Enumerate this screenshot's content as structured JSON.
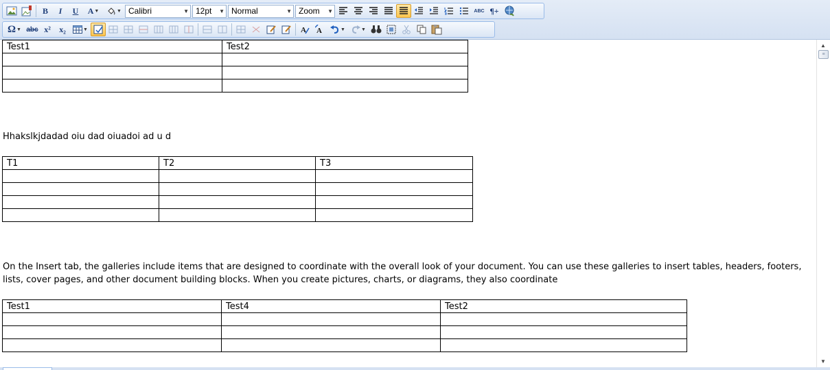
{
  "toolbar": {
    "font_family": "Calibri",
    "font_size": "12pt",
    "paragraph_style": "Normal",
    "zoom": "Zoom",
    "bold_glyph": "B",
    "italic_glyph": "I",
    "underline_glyph": "U",
    "font_color_glyph": "A",
    "omega_glyph": "Ω",
    "strikethrough_glyph": "abc",
    "superscript_glyph": "x²",
    "subscript_glyph": "x₂",
    "spellcheck_glyph": "ABC",
    "paragraph_mark_glyph": "¶+"
  },
  "document": {
    "table1": {
      "header": [
        "Test1",
        "Test2"
      ],
      "rows": [
        [
          "",
          ""
        ],
        [
          "",
          ""
        ],
        [
          "",
          ""
        ]
      ]
    },
    "para1": "Hhakslkjdadad oiu dad oiuadoi ad u d",
    "table2": {
      "header": [
        "T1",
        "T2",
        "T3"
      ],
      "rows": [
        [
          "",
          "",
          ""
        ],
        [
          "",
          "",
          ""
        ],
        [
          "",
          "",
          ""
        ],
        [
          "",
          "",
          ""
        ]
      ]
    },
    "para2_line1": "On the Insert tab, the galleries include items that are designed to coordinate with the overall look of your document. You can use these galleries to insert tables, headers, footers,",
    "para2_line2": "lists, cover pages, and other document building blocks. When you create pictures, charts, or diagrams, they also coordinate",
    "table3": {
      "header": [
        "Test1",
        "Test4",
        "Test2"
      ],
      "rows": [
        [
          "",
          "",
          ""
        ],
        [
          "",
          "",
          ""
        ],
        [
          "",
          "",
          ""
        ]
      ]
    }
  },
  "colors": {
    "toolbar_bg": "#dfe8f6",
    "active_button": "#ffc64f",
    "icon_blue": "#1f3f7a"
  }
}
